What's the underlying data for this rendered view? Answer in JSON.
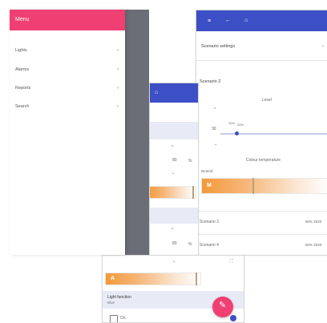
{
  "drawer": {
    "title": "Menu",
    "items": [
      {
        "label": "Lights",
        "chevron": "›"
      },
      {
        "label": "Alarms",
        "chevron": "›"
      },
      {
        "label": "Reports",
        "chevron": "›"
      },
      {
        "label": "Search",
        "chevron": "›"
      }
    ]
  },
  "middle_screen": {
    "value_top": "80",
    "unit_top": "%",
    "value_bottom": "80",
    "unit_bottom": "%"
  },
  "right_screen": {
    "header_label": "Scenario settings",
    "scenario_2_label": "Scenario 2",
    "level_label": "Level",
    "level_value": "30",
    "tick_1": "10%",
    "tick_2": "20%",
    "colour_temperature_label": "Colour temperature",
    "colour_sub_label": "Neutral",
    "bar_value": "M",
    "scenario_3_label": "Scenario 3",
    "scenario_3_value": "80% 2020",
    "scenario_4_label": "Scenario 4",
    "scenario_4_value": "60% 2020"
  },
  "bottom_screen": {
    "bar_value": "A",
    "light_function_label": "Light function",
    "light_function_value": "Blue",
    "checkbox_label": "On"
  },
  "colors": {
    "pink": "#ef3f73",
    "blue": "#3d4fc4",
    "orange": "#f39a3a"
  }
}
